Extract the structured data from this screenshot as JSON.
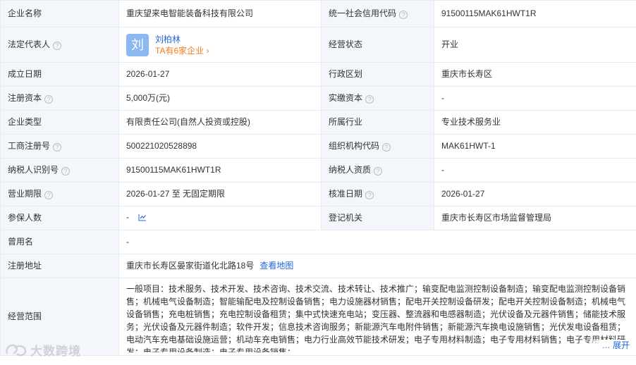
{
  "rows": {
    "company_name": {
      "label": "企业名称",
      "value": "重庆望来电智能装备科技有限公司"
    },
    "credit_code": {
      "label": "统一社会信用代码",
      "value": "91500115MAK61HWT1R"
    },
    "legal_rep": {
      "label": "法定代表人",
      "avatar_char": "刘",
      "name": "刘柏林",
      "companies": "TA有6家企业"
    },
    "status": {
      "label": "经营状态",
      "value": "开业"
    },
    "founded": {
      "label": "成立日期",
      "value": "2026-01-27"
    },
    "region": {
      "label": "行政区划",
      "value": "重庆市长寿区"
    },
    "reg_capital": {
      "label": "注册资本",
      "value": "5,000万(元)"
    },
    "paid_capital": {
      "label": "实缴资本",
      "value": "-"
    },
    "company_type": {
      "label": "企业类型",
      "value": "有限责任公司(自然人投资或控股)"
    },
    "industry": {
      "label": "所属行业",
      "value": "专业技术服务业"
    },
    "reg_no": {
      "label": "工商注册号",
      "value": "500221020528898"
    },
    "org_code": {
      "label": "组织机构代码",
      "value": "MAK61HWT-1"
    },
    "taxpayer_id": {
      "label": "纳税人识别号",
      "value": "91500115MAK61HWT1R"
    },
    "taxpayer_qual": {
      "label": "纳税人资质",
      "value": "-"
    },
    "term": {
      "label": "营业期限",
      "value": "2026-01-27 至 无固定期限"
    },
    "approval_date": {
      "label": "核准日期",
      "value": "2026-01-27"
    },
    "insured": {
      "label": "参保人数",
      "value": "-"
    },
    "authority": {
      "label": "登记机关",
      "value": "重庆市长寿区市场监督管理局"
    },
    "former_name": {
      "label": "曾用名",
      "value": "-"
    },
    "address": {
      "label": "注册地址",
      "value": "重庆市长寿区晏家街道化北路18号",
      "map_link": "查看地图"
    },
    "scope": {
      "label": "经营范围",
      "value": "一般项目：技术服务、技术开发、技术咨询、技术交流、技术转让、技术推广；输变配电监测控制设备制造；输变配电监测控制设备销售；机械电气设备制造；智能输配电及控制设备销售；电力设施器材销售；配电开关控制设备研发；配电开关控制设备制造；机械电气设备销售；充电桩销售；充电控制设备租赁；集中式快速充电站；变压器、整流器和电感器制造；光伏设备及元器件销售；储能技术服务；光伏设备及元器件制造；软件开发；信息技术咨询服务；新能源汽车电附件销售；新能源汽车换电设施销售；光伏发电设备租赁；电动汽车充电基础设施运营；机动车充电销售；电力行业高效节能技术研发；电子专用材料制造；电子专用材料销售；电子专用材料研发；电子专用设备制造；电子专用设备销售；",
      "expand": "展开"
    }
  },
  "watermark": "大数跨境",
  "colors": {
    "label_bg": "#f3f6fa",
    "border": "#e8ebf0",
    "link": "#1f67d9",
    "accent": "#f07a1f",
    "avatar": "#8cb8f2"
  }
}
